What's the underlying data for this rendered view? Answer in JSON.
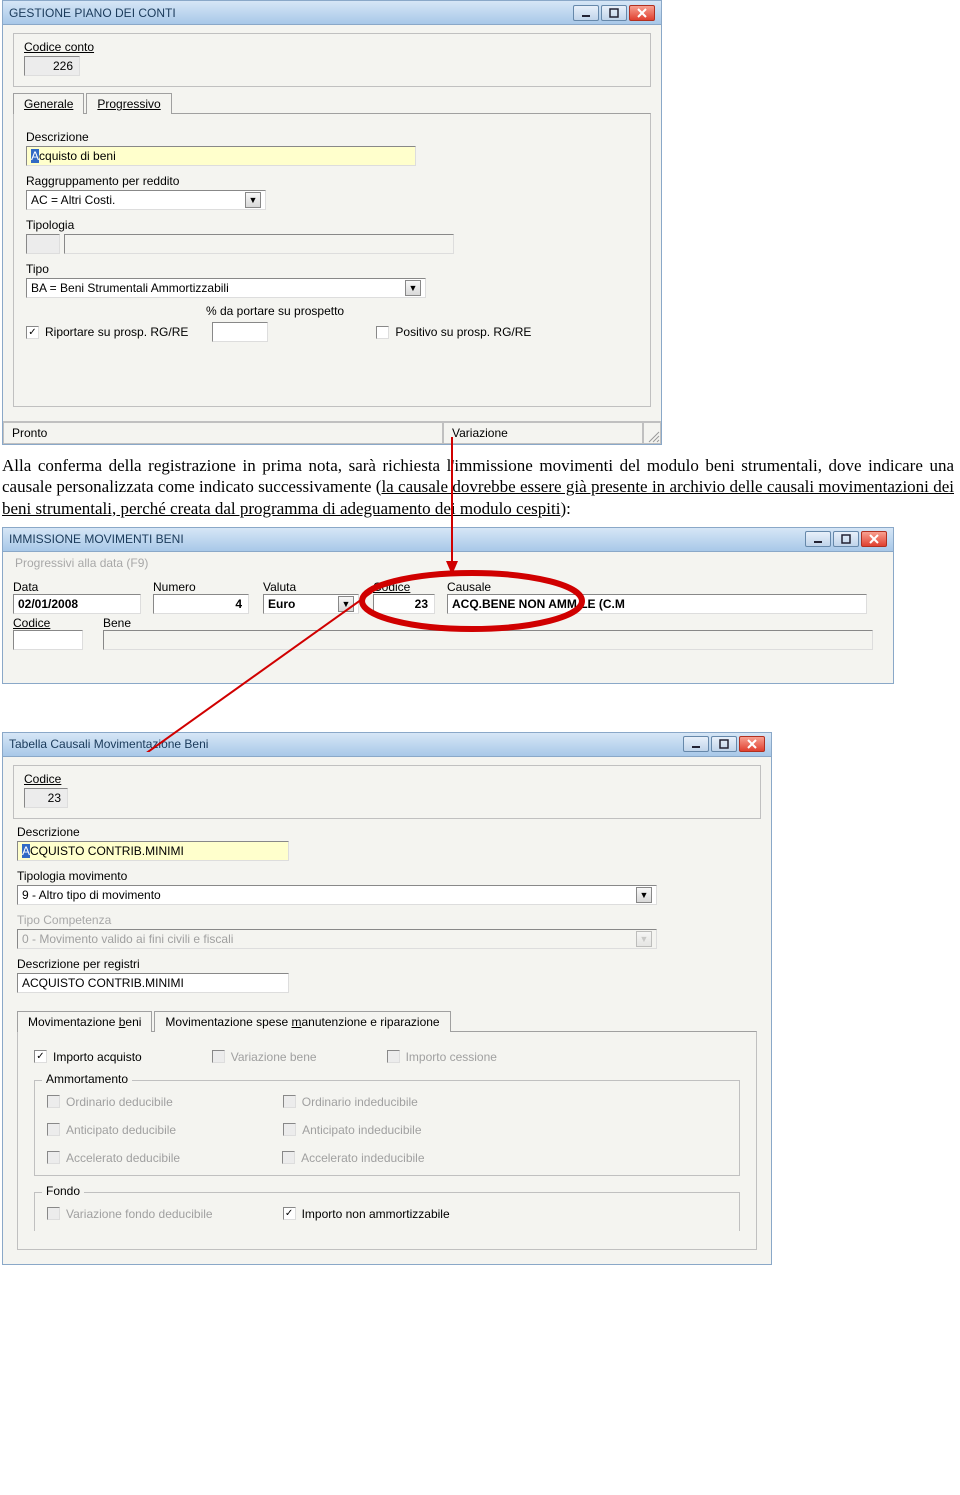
{
  "win1": {
    "title": "GESTIONE PIANO DEI CONTI",
    "codice_label": "Codice conto",
    "codice_value": "226",
    "tab_generale": "Generale",
    "tab_progressivo": "Progressivo",
    "descrizione_label": "Descrizione",
    "descrizione_value": "Acquisto di beni",
    "raggruppamento_label": "Raggruppamento per reddito",
    "raggruppamento_value": "AC = Altri Costi.",
    "tipologia_label": "Tipologia",
    "tipologia_value": "",
    "tipo_label": "Tipo",
    "tipo_value": "BA = Beni Strumentali Ammortizzabili",
    "riportare_label": "Riportare su prosp. RG/RE",
    "pct_label": "% da portare su prospetto",
    "positivo_label": "Positivo su prosp. RG/RE",
    "status_left": "Pronto",
    "status_right": "Variazione"
  },
  "paragraph": {
    "line1": "Alla conferma della registrazione in prima nota, sarà richiesta l'immissione movimenti del modulo beni strumentali, dove indicare una causale personalizzata come indicato successivamente (",
    "line2": "la causale dovrebbe essere già presente in archivio delle causali movimentazioni dei beni strumentali, perché creata dal programma di adeguamento dei modulo cespiti",
    "line3": "):"
  },
  "win2": {
    "title": "IMMISSIONE MOVIMENTI BENI",
    "menu": "Progressivi alla data (F9)",
    "data_label": "Data",
    "data_value": "02/01/2008",
    "numero_label": "Numero",
    "numero_value": "4",
    "valuta_label": "Valuta",
    "valuta_value": "Euro",
    "codice_label": "Codice",
    "codice_value": "23",
    "causale_label": "Causale",
    "causale_value": "ACQ.BENE NON AMM.LE (C.M",
    "codice2_label": "Codice",
    "bene_label": "Bene"
  },
  "win3": {
    "title": "Tabella Causali Movimentazione Beni",
    "codice_label": "Codice",
    "codice_value": "23",
    "descrizione_label": "Descrizione",
    "descrizione_value": "ACQUISTO CONTRIB.MINIMI",
    "tipologia_label": "Tipologia movimento",
    "tipologia_value": "9 - Altro tipo di movimento",
    "tipocomp_label": "Tipo Competenza",
    "tipocomp_value": "0 - Movimento valido ai fini civili e fiscali",
    "descreg_label": "Descrizione per registri",
    "descreg_value": "ACQUISTO CONTRIB.MINIMI",
    "tab_beni_pre": "Movimentazione ",
    "tab_beni_u": "b",
    "tab_beni_post": "eni",
    "tab_spese_pre": "Movimentazione spese ",
    "tab_spese_u": "m",
    "tab_spese_post": "anutenzione e riparazione",
    "chk_importo_acq": "Importo acquisto",
    "chk_var_bene_pre": "",
    "chk_var_bene_u": "V",
    "chk_var_bene_post": "ariazione bene",
    "chk_importo_cess_pre": "Importo ",
    "chk_importo_cess_u": "c",
    "chk_importo_cess_post": "essione",
    "group_amm": "Ammortamento",
    "chk_ord_ded_u": "O",
    "chk_ord_ded_post": "rdinario deducibile",
    "chk_ord_inded": "Ordinario indeducibile",
    "chk_ant_ded": "Anticipato deducibile",
    "chk_ant_inded_pre": "Antici",
    "chk_ant_inded_u": "p",
    "chk_ant_inded_post": "ato indeducibile",
    "chk_acc_ded": "Accelerato deducibile",
    "chk_acc_inded_pre": "Accele",
    "chk_acc_inded_u": "r",
    "chk_acc_inded_post": "ato indeducibile",
    "group_fondo": "Fondo",
    "chk_var_fondo_pre": "Variazione ",
    "chk_var_fondo_u": "f",
    "chk_var_fondo_post": "ondo deducibile",
    "chk_importo_non_amm": "Importo non ammortizzabile"
  }
}
